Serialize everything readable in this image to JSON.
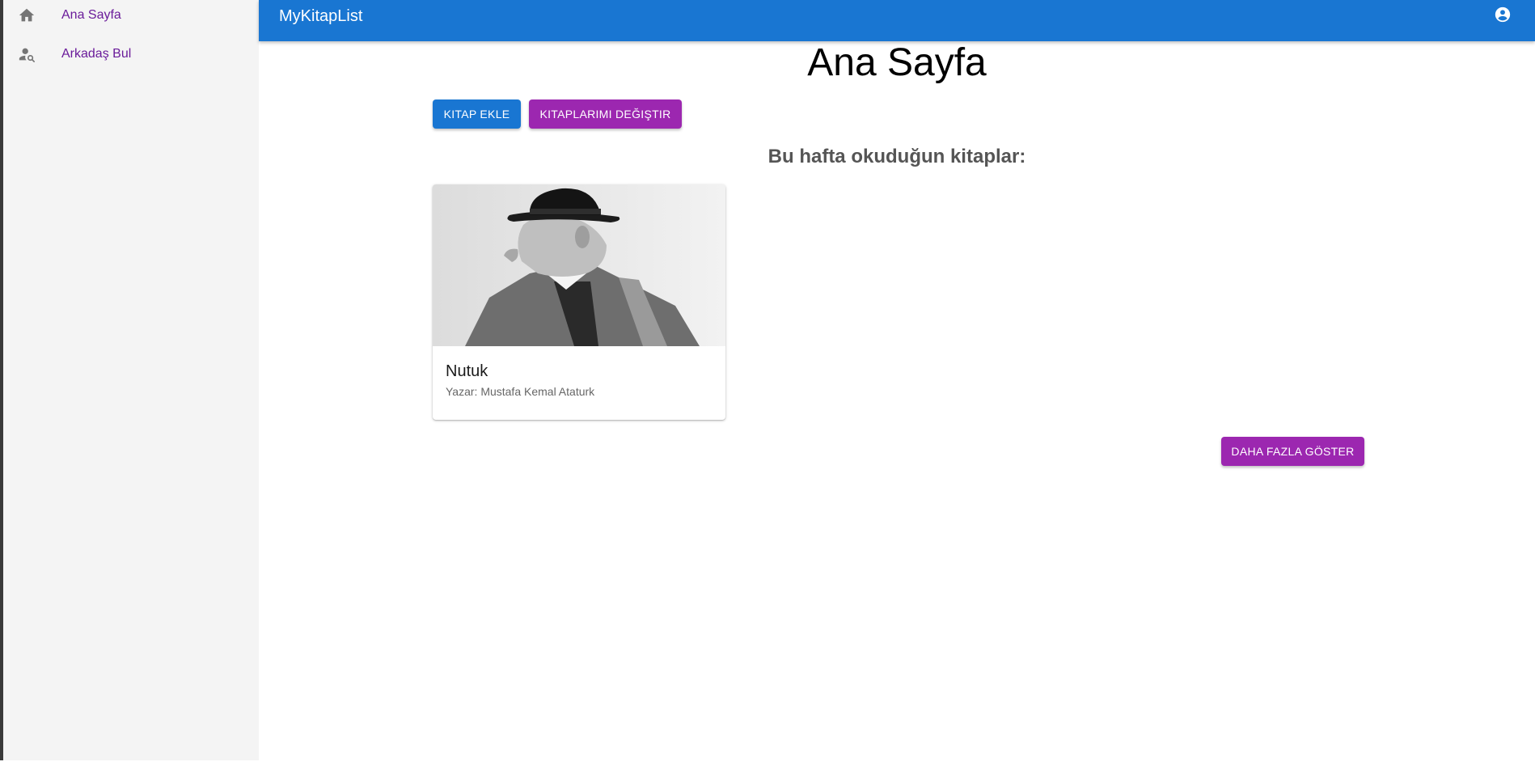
{
  "sidebar": {
    "items": [
      {
        "label": "Ana Sayfa",
        "icon": "home-icon"
      },
      {
        "label": "Arkadaş Bul",
        "icon": "person-search-icon"
      }
    ]
  },
  "appbar": {
    "title": "MyKitapList",
    "account_icon": "account-circle-icon"
  },
  "main": {
    "page_title": "Ana Sayfa",
    "add_book_label": "KITAP EKLE",
    "change_books_label": "KITAPLARIMI DEĞIŞTIR",
    "section_title": "Bu hafta okuduğun kitaplar:",
    "books": [
      {
        "title": "Nutuk",
        "author": "Yazar: Mustafa Kemal Ataturk"
      }
    ],
    "show_more_label": "DAHA FAZLA GÖSTER"
  },
  "colors": {
    "primary": "#1976d2",
    "secondary": "#9c27b0",
    "sidebar_bg": "#f4f4f4",
    "nav_text": "#6a1b9a"
  }
}
